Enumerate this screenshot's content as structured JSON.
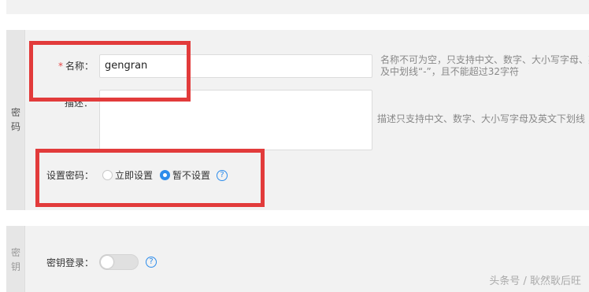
{
  "password_section": {
    "side_label": "密码",
    "name": {
      "required_mark": "*",
      "label": "名称：",
      "value": "gengran",
      "help_line1": "名称不可为空，只支持中文、数字、大小写字母、英",
      "help_line2": "及中划线“-”，且不能超过32字符"
    },
    "description": {
      "label": "描述：",
      "value": "",
      "help": "描述只支持中文、数字、大小写字母及英文下划线"
    },
    "set_password": {
      "label": "设置密码：",
      "options": [
        {
          "label": "立即设置",
          "selected": false
        },
        {
          "label": "暂不设置",
          "selected": true
        }
      ],
      "help_icon": "?"
    }
  },
  "key_section": {
    "side_label": "密钥",
    "key_login": {
      "label": "密钥登录：",
      "enabled": false,
      "help_icon": "?"
    }
  },
  "watermark": "头条号 / 耿然耿后旺",
  "colors": {
    "accent": "#2c8ceb",
    "highlight_box": "#e23b3b",
    "required": "#e64545",
    "panel_bg": "#f2f2f2"
  },
  "icons": [
    "question-circle-icon"
  ]
}
